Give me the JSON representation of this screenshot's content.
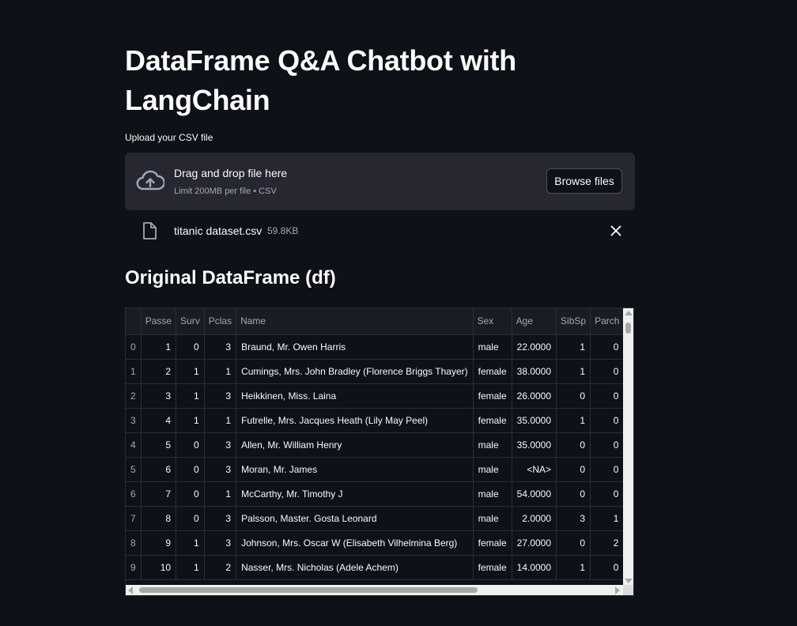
{
  "page": {
    "title": "DataFrame Q&A Chatbot with LangChain"
  },
  "uploader": {
    "label": "Upload your CSV file",
    "drop_title": "Drag and drop file here",
    "drop_limit": "Limit 200MB per file • CSV",
    "browse_label": "Browse files",
    "icon": "cloud-upload-icon"
  },
  "uploaded_file": {
    "name": "titanic dataset.csv",
    "size": "59.8KB",
    "icon": "file-icon"
  },
  "section": {
    "heading": "Original DataFrame (df)"
  },
  "dataframe": {
    "columns": [
      "",
      "Passe",
      "Surv",
      "Pclas",
      "Name",
      "Sex",
      "Age",
      "SibSp",
      "Parch"
    ],
    "rows": [
      [
        "0",
        "1",
        "0",
        "3",
        "Braund, Mr. Owen Harris",
        "male",
        "22.0000",
        "1",
        "0"
      ],
      [
        "1",
        "2",
        "1",
        "1",
        "Cumings, Mrs. John Bradley (Florence Briggs Thayer)",
        "female",
        "38.0000",
        "1",
        "0"
      ],
      [
        "2",
        "3",
        "1",
        "3",
        "Heikkinen, Miss. Laina",
        "female",
        "26.0000",
        "0",
        "0"
      ],
      [
        "3",
        "4",
        "1",
        "1",
        "Futrelle, Mrs. Jacques Heath (Lily May Peel)",
        "female",
        "35.0000",
        "1",
        "0"
      ],
      [
        "4",
        "5",
        "0",
        "3",
        "Allen, Mr. William Henry",
        "male",
        "35.0000",
        "0",
        "0"
      ],
      [
        "5",
        "6",
        "0",
        "3",
        "Moran, Mr. James",
        "male",
        "<NA>",
        "0",
        "0"
      ],
      [
        "6",
        "7",
        "0",
        "1",
        "McCarthy, Mr. Timothy J",
        "male",
        "54.0000",
        "0",
        "0"
      ],
      [
        "7",
        "8",
        "0",
        "3",
        "Palsson, Master. Gosta Leonard",
        "male",
        "2.0000",
        "3",
        "1"
      ],
      [
        "8",
        "9",
        "1",
        "3",
        "Johnson, Mrs. Oscar W (Elisabeth Vilhelmina Berg)",
        "female",
        "27.0000",
        "0",
        "2"
      ],
      [
        "9",
        "10",
        "1",
        "2",
        "Nasser, Mrs. Nicholas (Adele Achem)",
        "female",
        "14.0000",
        "1",
        "0"
      ]
    ]
  },
  "colors": {
    "background": "#0e1117",
    "surface": "#262730",
    "text": "#fafafa",
    "muted": "#a3a8b8"
  }
}
